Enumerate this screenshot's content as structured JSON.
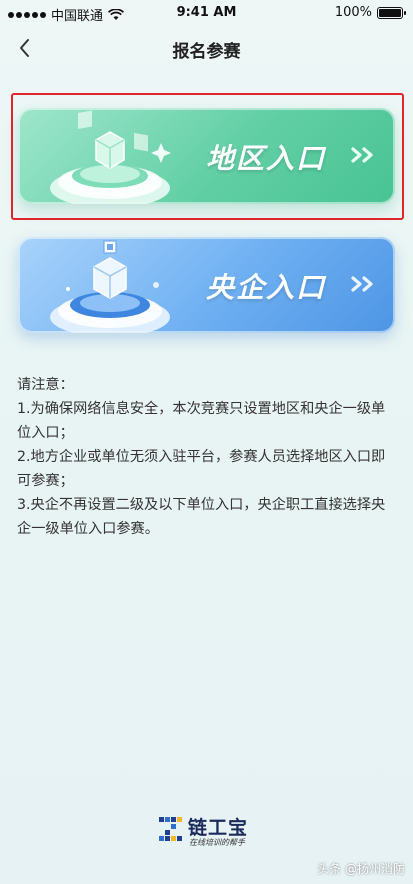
{
  "status_bar": {
    "carrier": "中国联通",
    "time": "9:41 AM",
    "battery_percent": "100%",
    "battery_level": 1.0
  },
  "nav": {
    "title": "报名参赛",
    "back_icon": "chevron-left-icon"
  },
  "entries": [
    {
      "label": "地区入口",
      "arrow_icon": "double-chevron-right-icon",
      "color": "#4fc79a",
      "selected": true
    },
    {
      "label": "央企入口",
      "arrow_icon": "double-chevron-right-icon",
      "color": "#5a9fea",
      "selected": false
    }
  ],
  "notice": {
    "heading": "请注意：",
    "items": [
      "1.为确保网络信息安全，本次竞赛只设置地区和央企一级单位入口；",
      "2.地方企业或单位无须入驻平台，参赛人员选择地区入口即可参赛；",
      "3.央企不再设置二级及以下单位入口，央企职工直接选择央企一级单位入口参赛。"
    ]
  },
  "brand": {
    "name": "链工宝",
    "slogan": "在线培训的帮手"
  },
  "watermark": "头条 @扬州消防",
  "highlight_color": "#e0262a"
}
